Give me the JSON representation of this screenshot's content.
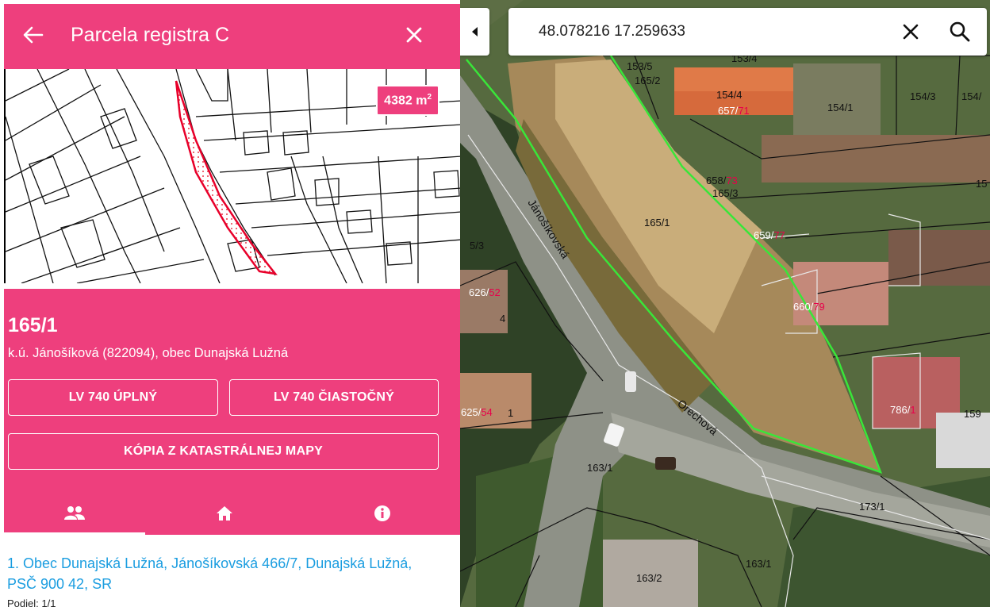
{
  "panel": {
    "title": "Parcela registra C",
    "area_value": "4382 m",
    "area_exp": "2",
    "parcel_number": "165/1",
    "location": "k.ú. Jánošíková (822094), obec Dunajská Lužná",
    "buttons": {
      "lv_full": "LV 740 ÚPLNÝ",
      "lv_partial": "LV 740 ČIASTOČNÝ",
      "map_copy": "KÓPIA Z KATASTRÁLNEJ MAPY"
    },
    "tabs": [
      {
        "icon": "people-icon"
      },
      {
        "icon": "home-icon"
      },
      {
        "icon": "info-icon"
      }
    ],
    "selected_tab": 0,
    "owner": {
      "text": "1. Obec Dunajská Lužná, Jánošíkovská 466/7, Dunajská Lužná, PSČ 900 42, SR",
      "share": "Podiel: 1/1"
    }
  },
  "search": {
    "value": "48.078216 17.259633"
  },
  "map": {
    "streets": [
      "Jánošíkovská",
      "Orechová"
    ],
    "parcel_labels": [
      {
        "id": "label-153-5",
        "text": "153/5"
      },
      {
        "id": "label-153-4",
        "text": "153/4"
      },
      {
        "id": "label-165-2",
        "text": "165/2"
      },
      {
        "id": "label-154-4",
        "text": "154/4"
      },
      {
        "id": "label-154-1",
        "text": "154/1"
      },
      {
        "id": "label-154-3",
        "text": "154/3"
      },
      {
        "id": "label-154-edge",
        "text": "154/"
      },
      {
        "id": "label-165-3",
        "text": "165/3"
      },
      {
        "id": "label-165-1",
        "text": "165/1"
      },
      {
        "id": "label-5-3",
        "text": "5/3"
      },
      {
        "id": "label-4",
        "text": "4"
      },
      {
        "id": "label-1",
        "text": "1"
      },
      {
        "id": "label-163-1a",
        "text": "163/1"
      },
      {
        "id": "label-163-1b",
        "text": "163/1"
      },
      {
        "id": "label-163-2",
        "text": "163/2"
      },
      {
        "id": "label-173-1",
        "text": "173/1"
      },
      {
        "id": "label-15",
        "text": "15"
      },
      {
        "id": "label-159",
        "text": "159"
      }
    ],
    "building_labels": [
      {
        "id": "bld-657",
        "num": "657/",
        "red": "71"
      },
      {
        "id": "bld-658",
        "num": "658/",
        "red": "73"
      },
      {
        "id": "bld-659",
        "num": "659/",
        "red": "77"
      },
      {
        "id": "bld-660",
        "num": "660/",
        "red": "79"
      },
      {
        "id": "bld-626",
        "num": "626/",
        "red": "52"
      },
      {
        "id": "bld-625",
        "num": "625/",
        "red": "54"
      },
      {
        "id": "bld-786",
        "num": "786/",
        "red": "1"
      }
    ]
  },
  "colors": {
    "accent": "#ee3f7d",
    "parcel_outline": "#39e639",
    "owner_link": "#1a9de0"
  }
}
